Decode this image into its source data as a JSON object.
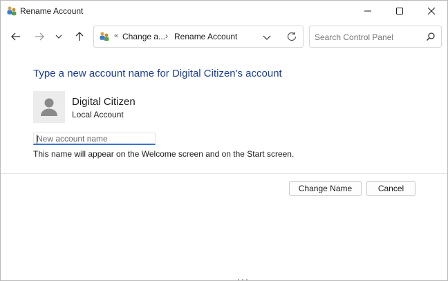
{
  "window": {
    "title": "Rename Account"
  },
  "titlebar_controls": {
    "minimize_icon": "minimize-icon",
    "maximize_icon": "maximize-icon",
    "close_icon": "close-icon"
  },
  "nav": {
    "back_icon": "arrow-left-icon",
    "forward_icon": "arrow-right-icon",
    "recent_icon": "chevron-down-icon",
    "up_icon": "arrow-up-icon"
  },
  "address": {
    "overflow": "«",
    "crumbs": [
      "Change a...",
      "Rename Account"
    ],
    "separator": "›"
  },
  "search": {
    "placeholder": "Search Control Panel"
  },
  "content": {
    "heading": "Type a new account name for Digital Citizen's account",
    "user_name": "Digital Citizen",
    "user_type": "Local Account",
    "input_placeholder": "New account name",
    "input_value": "",
    "hint": "This name will appear on the Welcome screen and on the Start screen."
  },
  "buttons": {
    "change_name": "Change Name",
    "cancel": "Cancel"
  },
  "colors": {
    "heading": "#1c3f95",
    "input_focus": "#3c6fd1"
  }
}
